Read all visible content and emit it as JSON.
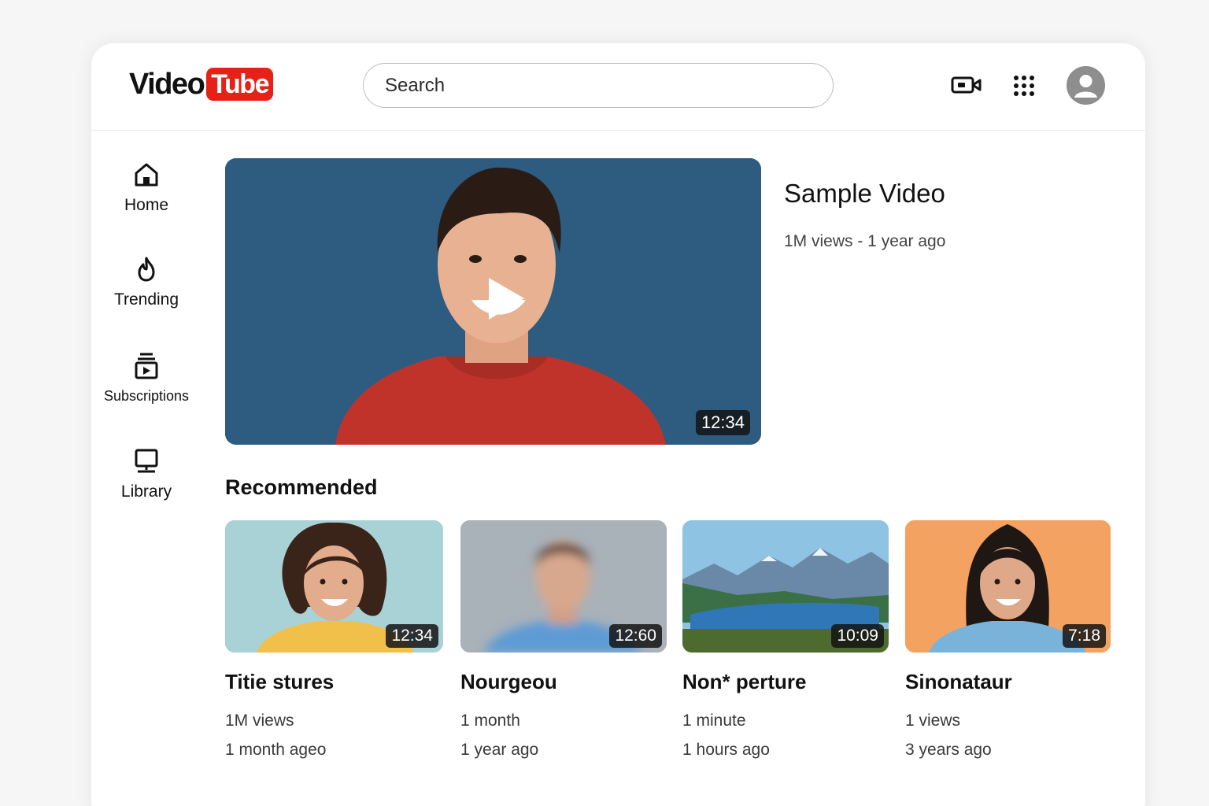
{
  "app": {
    "logo_text": "Video",
    "logo_badge": "Tube",
    "brand_color": "#e62117"
  },
  "search": {
    "placeholder": "Search",
    "value": ""
  },
  "header_icons": [
    "video-camera-icon",
    "apps-grid-icon",
    "account-avatar-icon"
  ],
  "sidebar": {
    "items": [
      {
        "label": "Home",
        "icon": "home-icon"
      },
      {
        "label": "Trending",
        "icon": "flame-icon"
      },
      {
        "label": "Subscriptions",
        "icon": "subscriptions-icon"
      },
      {
        "label": "Library",
        "icon": "library-icon"
      }
    ]
  },
  "featured": {
    "title": "Sample Video",
    "meta": "1M views - 1 year ago",
    "duration": "12:34",
    "thumbnail_bg": "#2d5c80"
  },
  "recommended": {
    "heading": "Recommended",
    "videos": [
      {
        "title": "Titie stures",
        "line1": "1M views",
        "line2": "1 month ageo",
        "duration": "12:34",
        "thumbnail_bg": "#a9d2d6"
      },
      {
        "title": "Nourgeou",
        "line1": "1 month",
        "line2": "1 year ago",
        "duration": "12:60",
        "thumbnail_bg": "#a9b1b9"
      },
      {
        "title": "Non* perture",
        "line1": "1 minute",
        "line2": "1 hours ago",
        "duration": "10:09",
        "thumbnail_bg": "#8fc3e4"
      },
      {
        "title": "Sinonataur",
        "line1": "1 views",
        "line2": "3 years ago",
        "duration": "7:18",
        "thumbnail_bg": "#f4a262"
      }
    ]
  }
}
